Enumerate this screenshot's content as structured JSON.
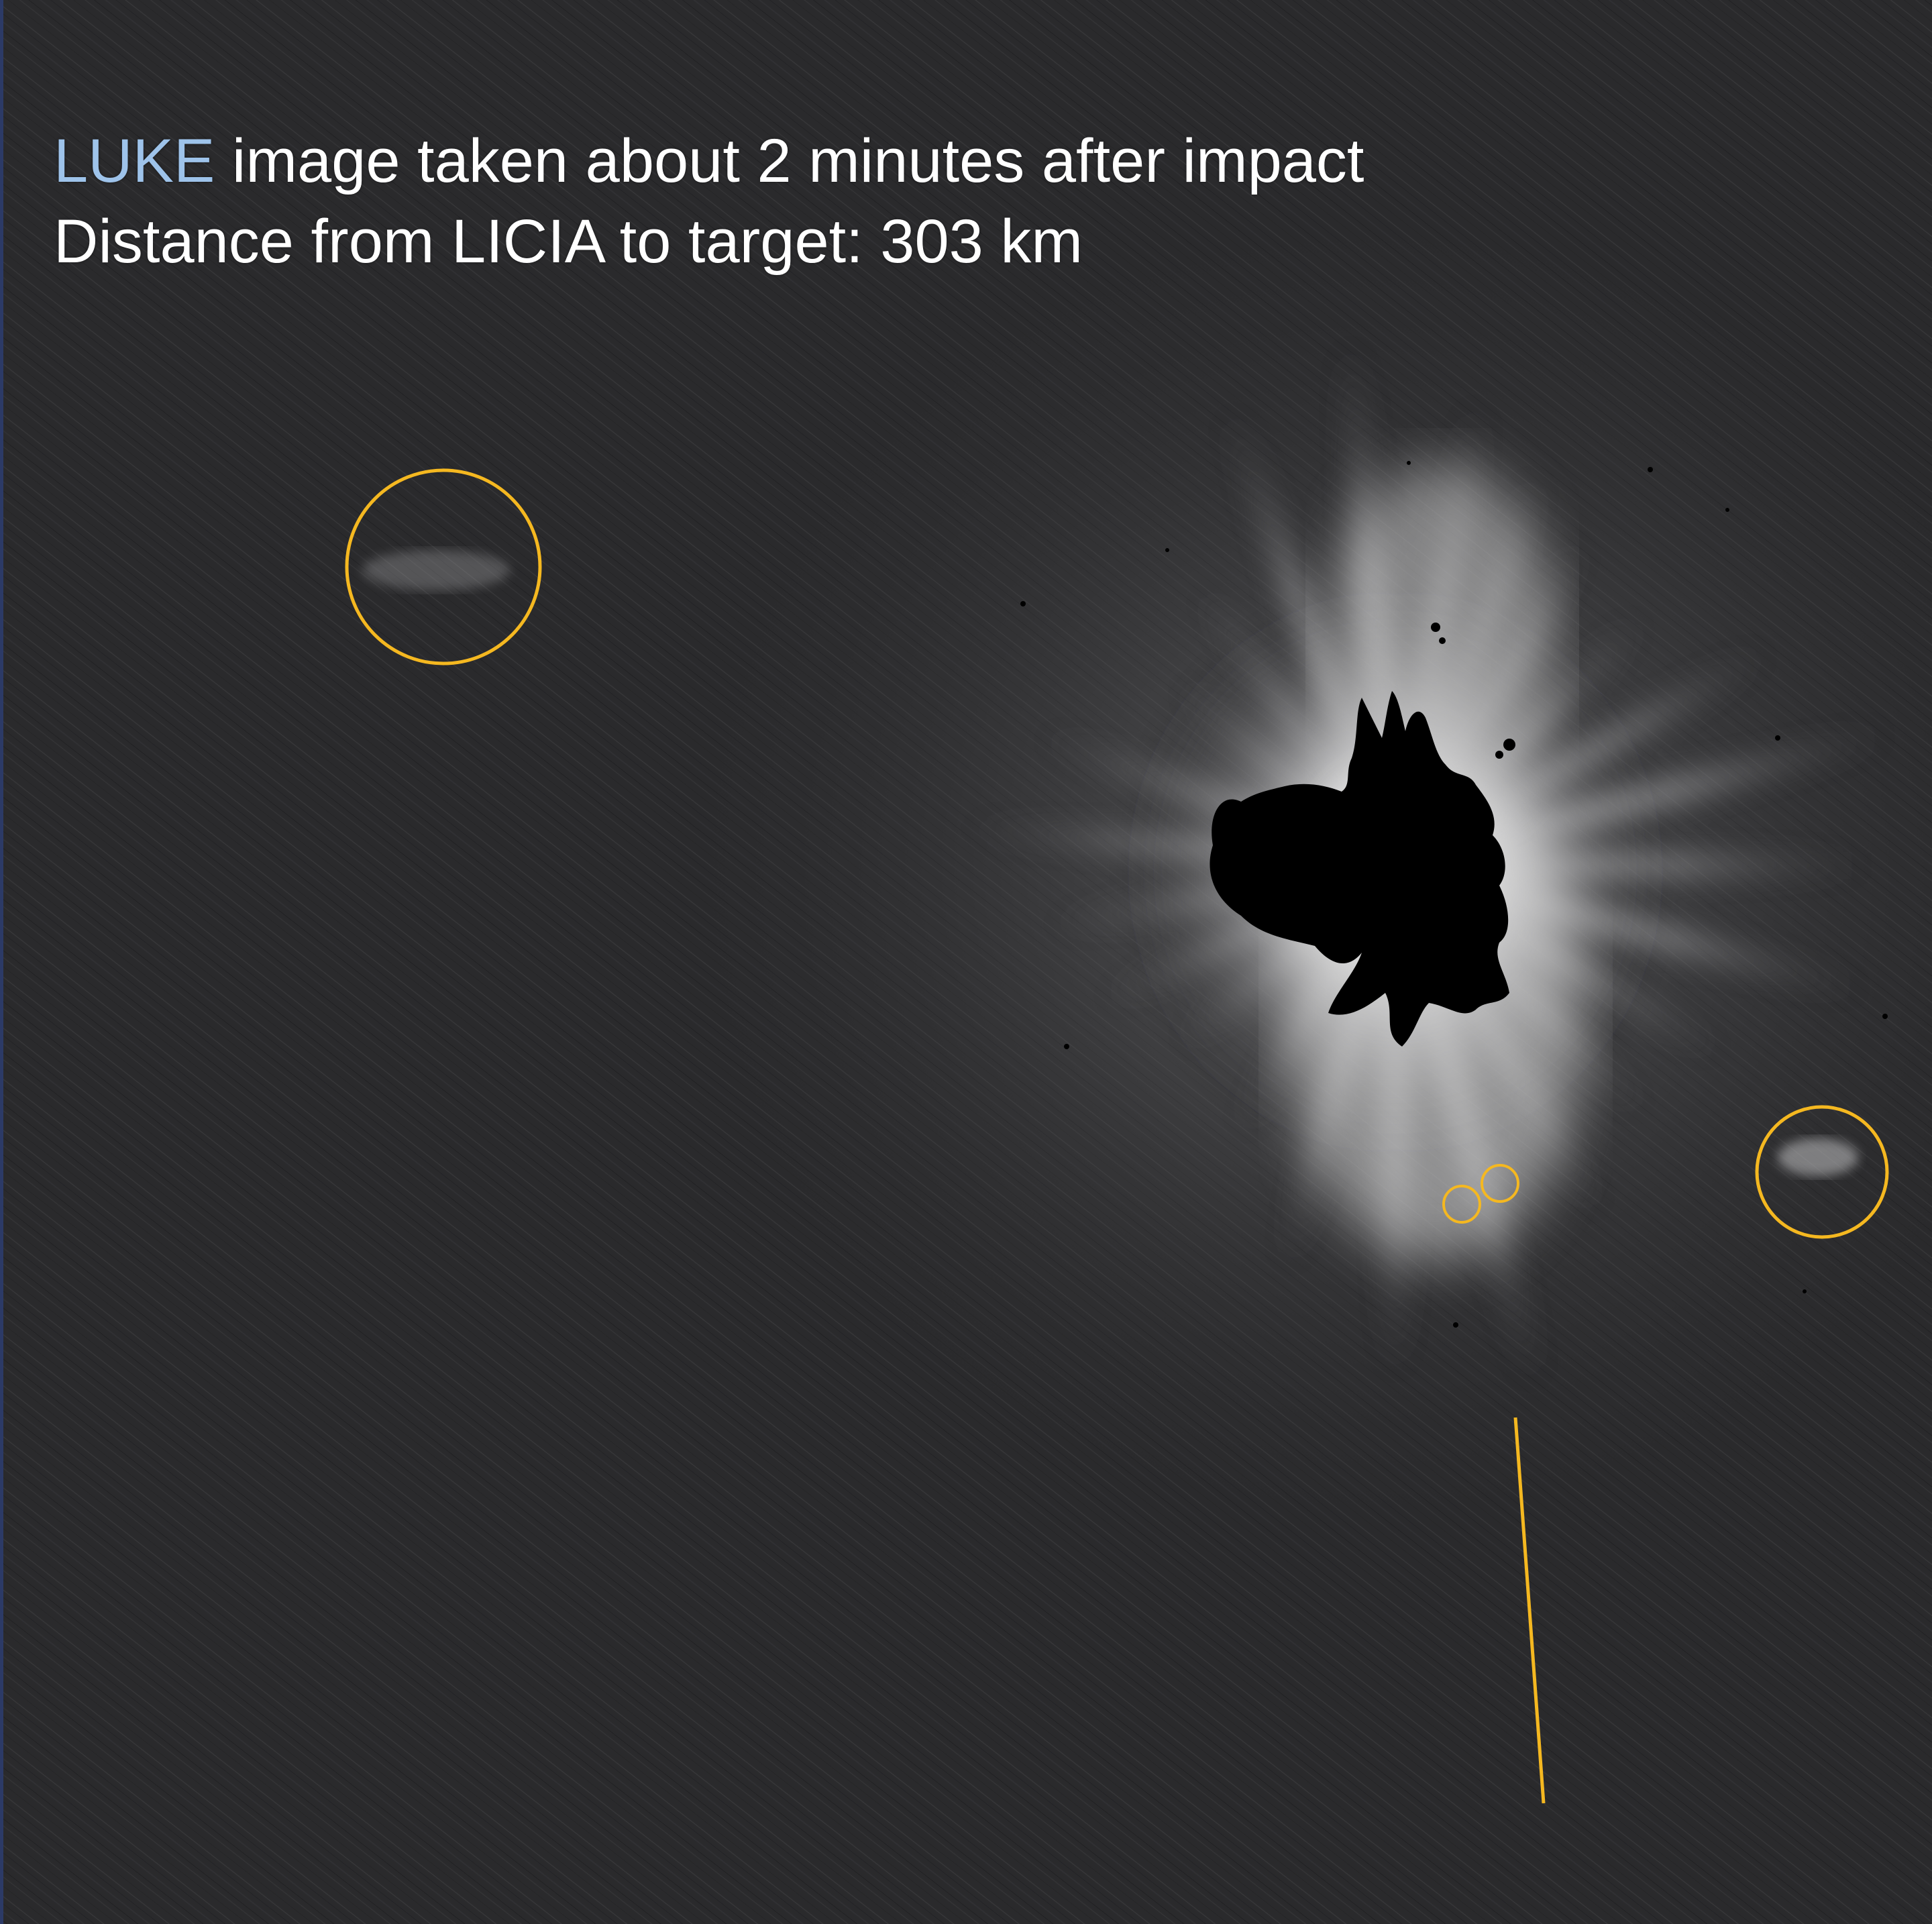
{
  "caption": {
    "instrument": "LUKE",
    "line1_rest": " image taken about 2 minutes after impact",
    "line2": "Distance from LICIA to target: 303 km"
  },
  "colors": {
    "background": "#2a2a2c",
    "accent_text": "#9ec3ea",
    "body_text": "#ffffff",
    "annotation": "#f5b820",
    "asteroid": "#000000"
  },
  "annotations": {
    "circle_count": 4,
    "line_count": 1
  }
}
